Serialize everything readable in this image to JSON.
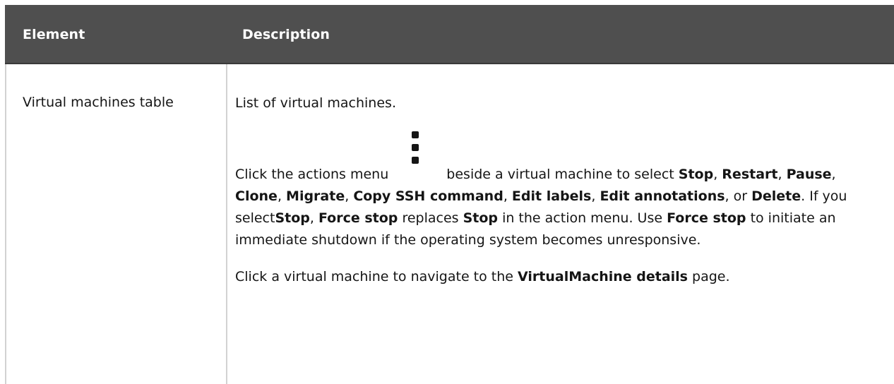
{
  "table": {
    "headers": {
      "element": "Element",
      "description": "Description"
    },
    "row": {
      "element": "Virtual machines table",
      "description": {
        "p1": "List of virtual machines.",
        "p2": {
          "t1": "Click the actions menu",
          "icon": "kebab-vertical-icon",
          "t2": " beside a virtual machine to select ",
          "stop": "Stop",
          "sep1": ", ",
          "restart": "Restart",
          "sep2": ", ",
          "pause": "Pause",
          "sep3": ", ",
          "clone": "Clone",
          "sep4": ", ",
          "migrate": "Migrate",
          "sep5": ", ",
          "copy_ssh": "Copy SSH command",
          "sep6": ", ",
          "edit_labels": "Edit labels",
          "sep7": ", ",
          "edit_annotations": "Edit annotations",
          "sep8": ", or ",
          "delete": "Delete",
          "t3": ". If you select",
          "stop2": "Stop",
          "sep9": ", ",
          "force_stop": "Force stop",
          "t4": " replaces ",
          "stop3": "Stop",
          "t5": " in the action menu. Use ",
          "force_stop2": "Force stop",
          "t6": " to initiate an immediate shutdown if the operating system becomes unresponsive."
        },
        "p3": {
          "t1": "Click a virtual machine to navigate to the ",
          "vm_details": "VirtualMachine details",
          "t2": " page."
        }
      }
    }
  }
}
